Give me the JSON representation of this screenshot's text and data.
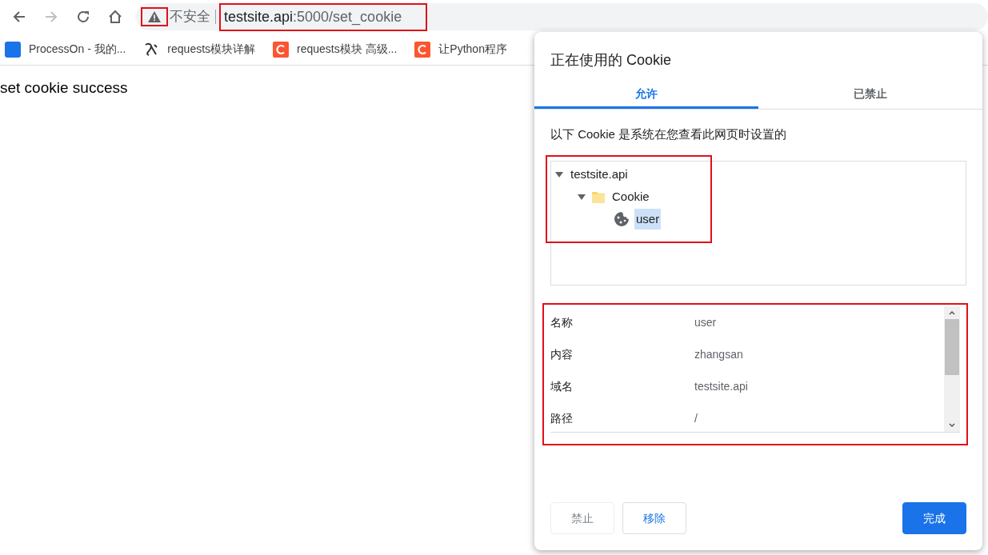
{
  "toolbar": {
    "security_label": "不安全",
    "url_host": "testsite.api",
    "url_rest": ":5000/set_cookie"
  },
  "bookmarks": [
    {
      "label": "ProcessOn - 我的...",
      "kind": "on"
    },
    {
      "label": "requests模块详解",
      "kind": "script"
    },
    {
      "label": "requests模块 高级...",
      "kind": "c"
    },
    {
      "label": "让Python程序",
      "kind": "c"
    }
  ],
  "page": {
    "text": "set cookie success"
  },
  "dialog": {
    "title": "正在使用的 Cookie",
    "tabs": [
      {
        "label": "允许",
        "selected": true
      },
      {
        "label": "已禁止",
        "selected": false
      }
    ],
    "description": "以下 Cookie 是系统在您查看此网页时设置的",
    "tree": [
      {
        "label": "testsite.api",
        "expanded": true,
        "selected": false,
        "children": [
          {
            "label": "Cookie",
            "kind": "folder",
            "expanded": true,
            "selected": false,
            "children": [
              {
                "label": "user",
                "kind": "cookie",
                "selected": true
              }
            ]
          }
        ]
      }
    ],
    "details": [
      {
        "label": "名称",
        "value": "user"
      },
      {
        "label": "内容",
        "value": "zhangsan"
      },
      {
        "label": "域名",
        "value": "testsite.api"
      },
      {
        "label": "路径",
        "value": "/"
      }
    ],
    "buttons": [
      {
        "label": "禁止",
        "kind": "secondary",
        "disabled": true
      },
      {
        "label": "移除",
        "kind": "secondary",
        "disabled": false
      },
      {
        "label": "完成",
        "kind": "primary",
        "disabled": false
      }
    ]
  }
}
